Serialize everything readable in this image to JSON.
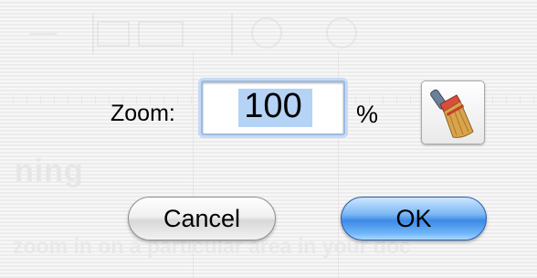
{
  "dialog": {
    "zoom_label": "Zoom:",
    "zoom_value": "100",
    "unit_label": "%",
    "clear_icon": "broom-icon",
    "cancel_label": "Cancel",
    "ok_label": "OK"
  },
  "background": {
    "heading_fragment": "ning",
    "body_fragment": "zoom in on a particular area in your doc"
  },
  "colors": {
    "focus_ring": "#9bbbe6",
    "selection": "#b5d3f5",
    "ok_button": "#3d8ae6"
  }
}
